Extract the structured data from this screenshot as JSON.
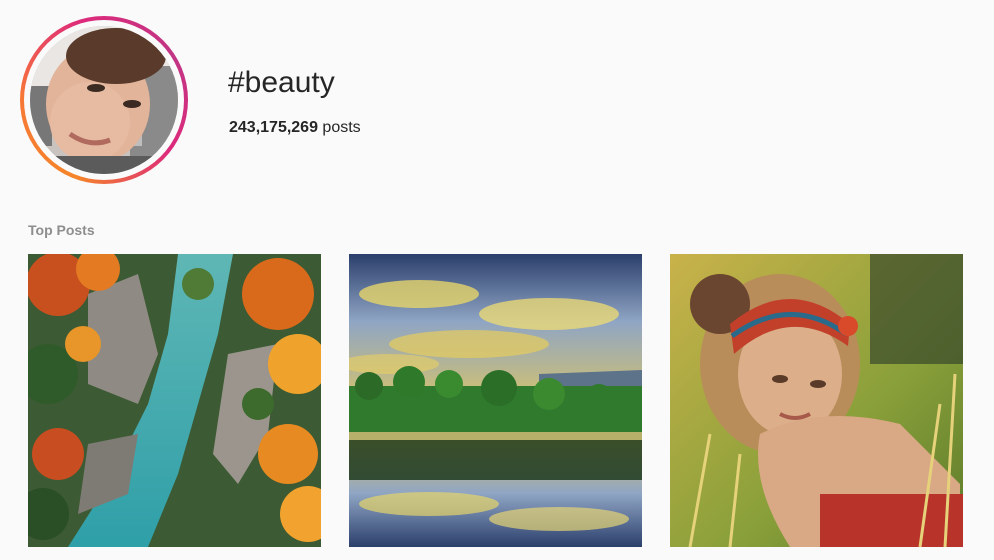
{
  "hashtag": {
    "title": "#beauty",
    "post_count": "243,175,269",
    "post_count_suffix": " posts"
  },
  "sections": {
    "top_posts_label": "Top Posts"
  },
  "top_posts": [
    {
      "image_subject": "river-canyon-autumn-forest"
    },
    {
      "image_subject": "palm-trees-lake-reflection-sunset"
    },
    {
      "image_subject": "woman-with-headband-in-grass"
    }
  ],
  "colors": {
    "background": "#fafafa",
    "ring_gradient": [
      "#f58529",
      "#dd2a7b",
      "#c13584"
    ],
    "text_primary": "#262626",
    "text_secondary": "#8e8e8e"
  }
}
